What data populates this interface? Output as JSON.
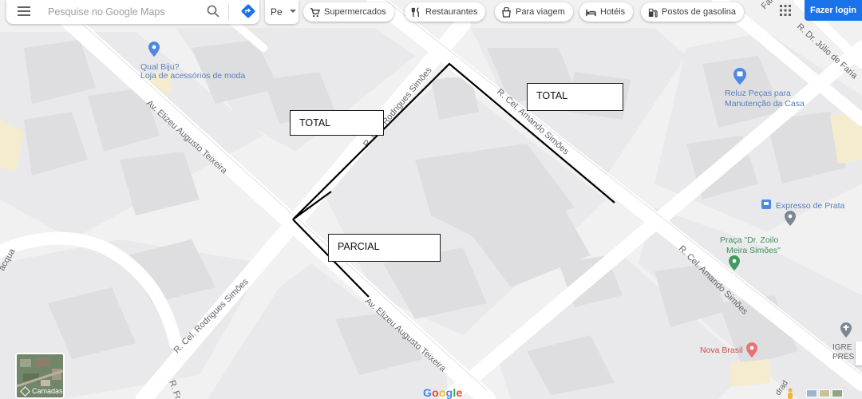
{
  "search": {
    "placeholder": "Pesquise no Google Maps"
  },
  "partial_dropdown": {
    "text": "Pe"
  },
  "chips": [
    {
      "label": "Supermercados",
      "icon": "shopping-cart-icon"
    },
    {
      "label": "Restaurantes",
      "icon": "fork-knife-icon"
    },
    {
      "label": "Para viagem",
      "icon": "takeout-bag-icon"
    },
    {
      "label": "Hotéis",
      "icon": "bed-icon"
    },
    {
      "label": "Postos de gasolina",
      "icon": "gas-pump-icon"
    }
  ],
  "login_button": "Fazer login",
  "streets": {
    "elizeu_upper": "Av. Elizeu Augusto Teixeira",
    "elizeu_lower": "Av. Elizeu Augusto Teixeira",
    "rodrigues_upper": "R. Cel. Rodrigues Simões",
    "rodrigues_lower": "R. Cel. Rodrigues Simões",
    "amando_upper": "R. Cel. Amando Simões",
    "amando_lower": "R. Cel. Amando Simões",
    "julio": "R. Dr. Júlio de Faria",
    "top_partial": "Faria",
    "left_partial": "acqua",
    "bottom_left_partial": "R. Fr",
    "bottom_right_partial": "drad"
  },
  "pois": {
    "qual_biju": {
      "name": "Qual Biju?",
      "category": "Loja de acessórios de moda"
    },
    "reluz": {
      "line1": "Reluz Peças para",
      "line2": "Manutenção da Casa"
    },
    "expresso": "Expresso de Prata",
    "praca": {
      "line1": "Praça \"Dr. Zoilo",
      "line2": "Meira Simões\""
    },
    "nova_brasil": "Nova Brasil",
    "igreja": {
      "line1": "IGRE",
      "line2": "PRES"
    }
  },
  "annotations": {
    "total_left": "TOTAL",
    "total_right": "TOTAL",
    "parcial": "PARCIAL"
  },
  "layers_button": "Camadas",
  "google_logo": [
    "G",
    "o",
    "o",
    "g",
    "l",
    "e"
  ],
  "colors": {
    "map_background": "#f3f3f4",
    "road": "#ffffff",
    "block": "#e8e8ea",
    "building": "#dadadd",
    "accent_blue": "#1a73e8",
    "annotation_line": "#000000"
  }
}
